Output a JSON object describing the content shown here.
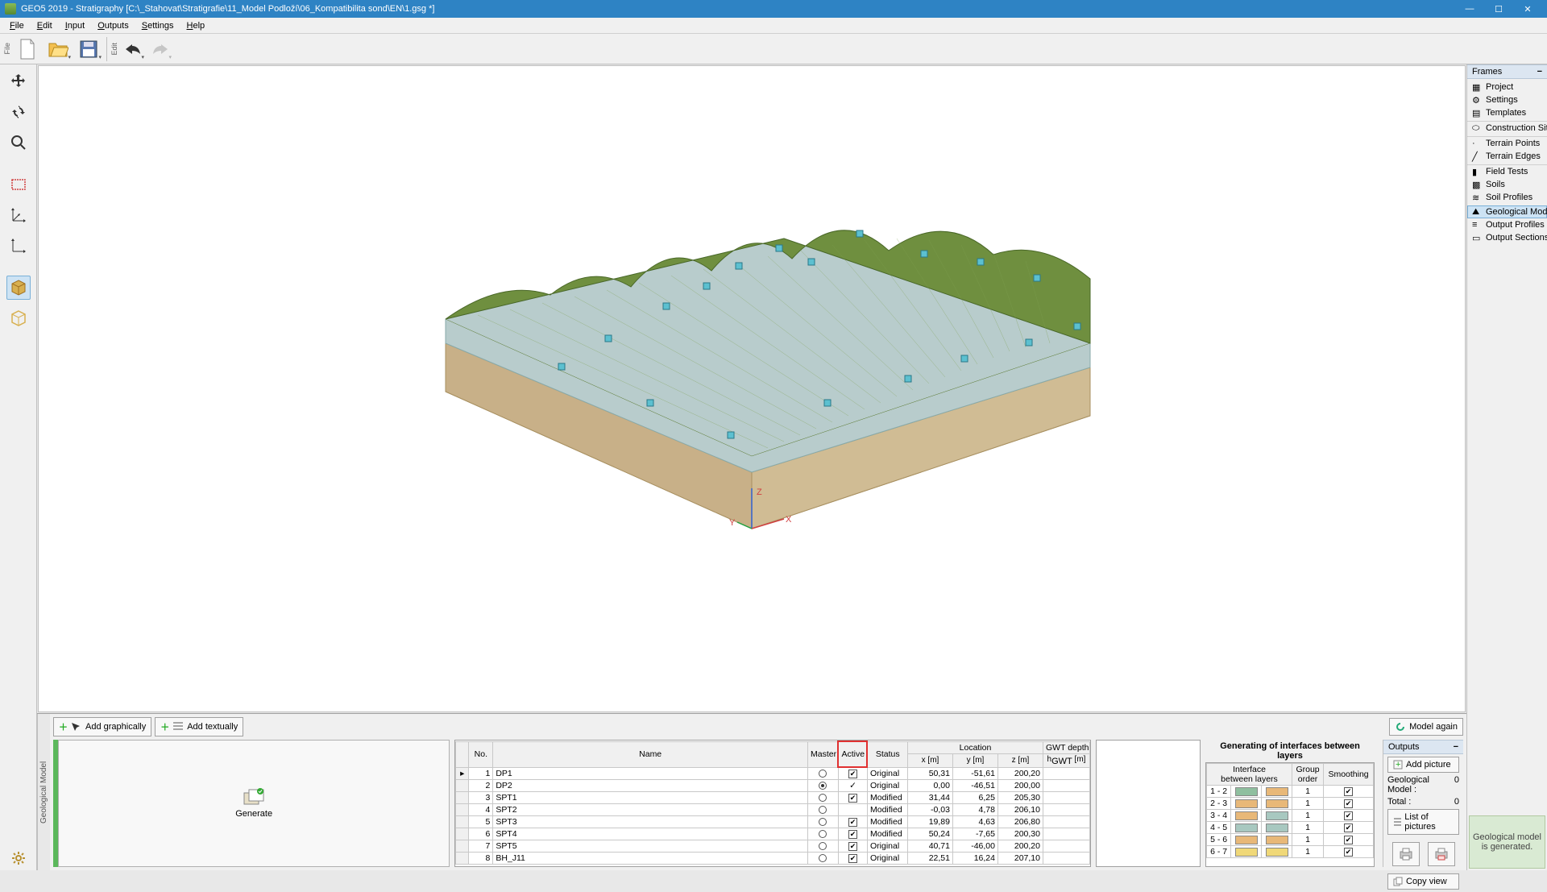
{
  "app": {
    "title": "GEO5 2019 - Stratigraphy [C:\\_Stahovat\\Stratigrafie\\11_Model Podloží\\06_Kompatibilita sond\\EN\\1.gsg *]"
  },
  "menu": [
    "File",
    "Edit",
    "Input",
    "Outputs",
    "Settings",
    "Help"
  ],
  "toolbar_groups": {
    "file_label": "File",
    "edit_label": "Edit"
  },
  "frames": {
    "header": "Frames",
    "g1": [
      {
        "icon": "project",
        "label": "Project"
      },
      {
        "icon": "settings",
        "label": "Settings"
      },
      {
        "icon": "templates",
        "label": "Templates"
      }
    ],
    "g2": [
      {
        "icon": "site",
        "label": "Construction Site"
      }
    ],
    "g3": [
      {
        "icon": "tpoints",
        "label": "Terrain Points"
      },
      {
        "icon": "tedges",
        "label": "Terrain Edges"
      }
    ],
    "g4": [
      {
        "icon": "ftests",
        "label": "Field Tests"
      },
      {
        "icon": "soils",
        "label": "Soils"
      },
      {
        "icon": "sprof",
        "label": "Soil Profiles"
      }
    ],
    "g5": [
      {
        "icon": "gmodel",
        "label": "Geological Model",
        "sel": true
      },
      {
        "icon": "oprof",
        "label": "Output Profiles"
      },
      {
        "icon": "osect",
        "label": "Output Sections"
      }
    ]
  },
  "status_msg": "Geological model\nis generated.",
  "model_again": "Model again",
  "bottom": {
    "tab_label": "Geological Model",
    "add_graph": "Add graphically",
    "add_text": "Add textually",
    "generate": "Generate",
    "headers": {
      "no": "No.",
      "name": "Name",
      "master": "Master",
      "active": "Active",
      "status": "Status",
      "location": "Location",
      "gwt": "GWT depth",
      "x": "x [m]",
      "y": "y [m]",
      "z": "z [m]",
      "hgwt": "hGWT [m]"
    },
    "rows": [
      {
        "no": 1,
        "name": "DP1",
        "master": false,
        "active": "chk",
        "active_bg": "",
        "status": "Original",
        "x": "50,31",
        "y": "-51,61",
        "z": "200,20",
        "g": ""
      },
      {
        "no": 2,
        "name": "DP2",
        "master": true,
        "active": "tick",
        "active_bg": "",
        "status": "Original",
        "x": "0,00",
        "y": "-46,51",
        "z": "200,00",
        "g": ""
      },
      {
        "no": 3,
        "name": "SPT1",
        "master": false,
        "active": "chk",
        "active_bg": "",
        "status": "Modified",
        "x": "31,44",
        "y": "6,25",
        "z": "205,30",
        "g": ""
      },
      {
        "no": 4,
        "name": "SPT2",
        "master": false,
        "active": "none",
        "active_bg": "red",
        "status": "Modified",
        "x": "-0,03",
        "y": "4,78",
        "z": "206,10",
        "g": ""
      },
      {
        "no": 5,
        "name": "SPT3",
        "master": false,
        "active": "chk",
        "active_bg": "",
        "status": "Modified",
        "x": "19,89",
        "y": "4,63",
        "z": "206,80",
        "g": ""
      },
      {
        "no": 6,
        "name": "SPT4",
        "master": false,
        "active": "chk",
        "active_bg": "",
        "status": "Modified",
        "x": "50,24",
        "y": "-7,65",
        "z": "200,30",
        "g": ""
      },
      {
        "no": 7,
        "name": "SPT5",
        "master": false,
        "active": "chk",
        "active_bg": "",
        "status": "Original",
        "x": "40,71",
        "y": "-46,00",
        "z": "200,20",
        "g": ""
      },
      {
        "no": 8,
        "name": "BH_J11",
        "master": false,
        "active": "chk",
        "active_bg": "",
        "status": "Original",
        "x": "22,51",
        "y": "16,24",
        "z": "207,10",
        "g": ""
      }
    ],
    "iface_title": "Generating of interfaces between layers",
    "iface_headers": {
      "iface": "Interface\nbetween layers",
      "group": "Group\norder",
      "smooth": "Smoothing"
    },
    "iface_rows": [
      {
        "r": "1 - 2",
        "c1": "#8fbf9f",
        "c2": "#e8b878",
        "g": 1,
        "s": true
      },
      {
        "r": "2 - 3",
        "c1": "#e8b878",
        "c2": "#e8b878",
        "g": 1,
        "s": true
      },
      {
        "r": "3 - 4",
        "c1": "#e8b878",
        "c2": "#a8c8c0",
        "g": 1,
        "s": true
      },
      {
        "r": "4 - 5",
        "c1": "#a8c8c0",
        "c2": "#a8c8c0",
        "g": 1,
        "s": true
      },
      {
        "r": "5 - 6",
        "c1": "#e8b878",
        "c2": "#e8b878",
        "g": 1,
        "s": true
      },
      {
        "r": "6 - 7",
        "c1": "#f0d878",
        "c2": "#f0d878",
        "g": 1,
        "s": true
      }
    ]
  },
  "outputs": {
    "header": "Outputs",
    "add_picture": "Add picture",
    "gm_label": "Geological Model :",
    "gm_val": "0",
    "total_label": "Total :",
    "total_val": "0",
    "list": "List of pictures",
    "copy": "Copy view"
  }
}
